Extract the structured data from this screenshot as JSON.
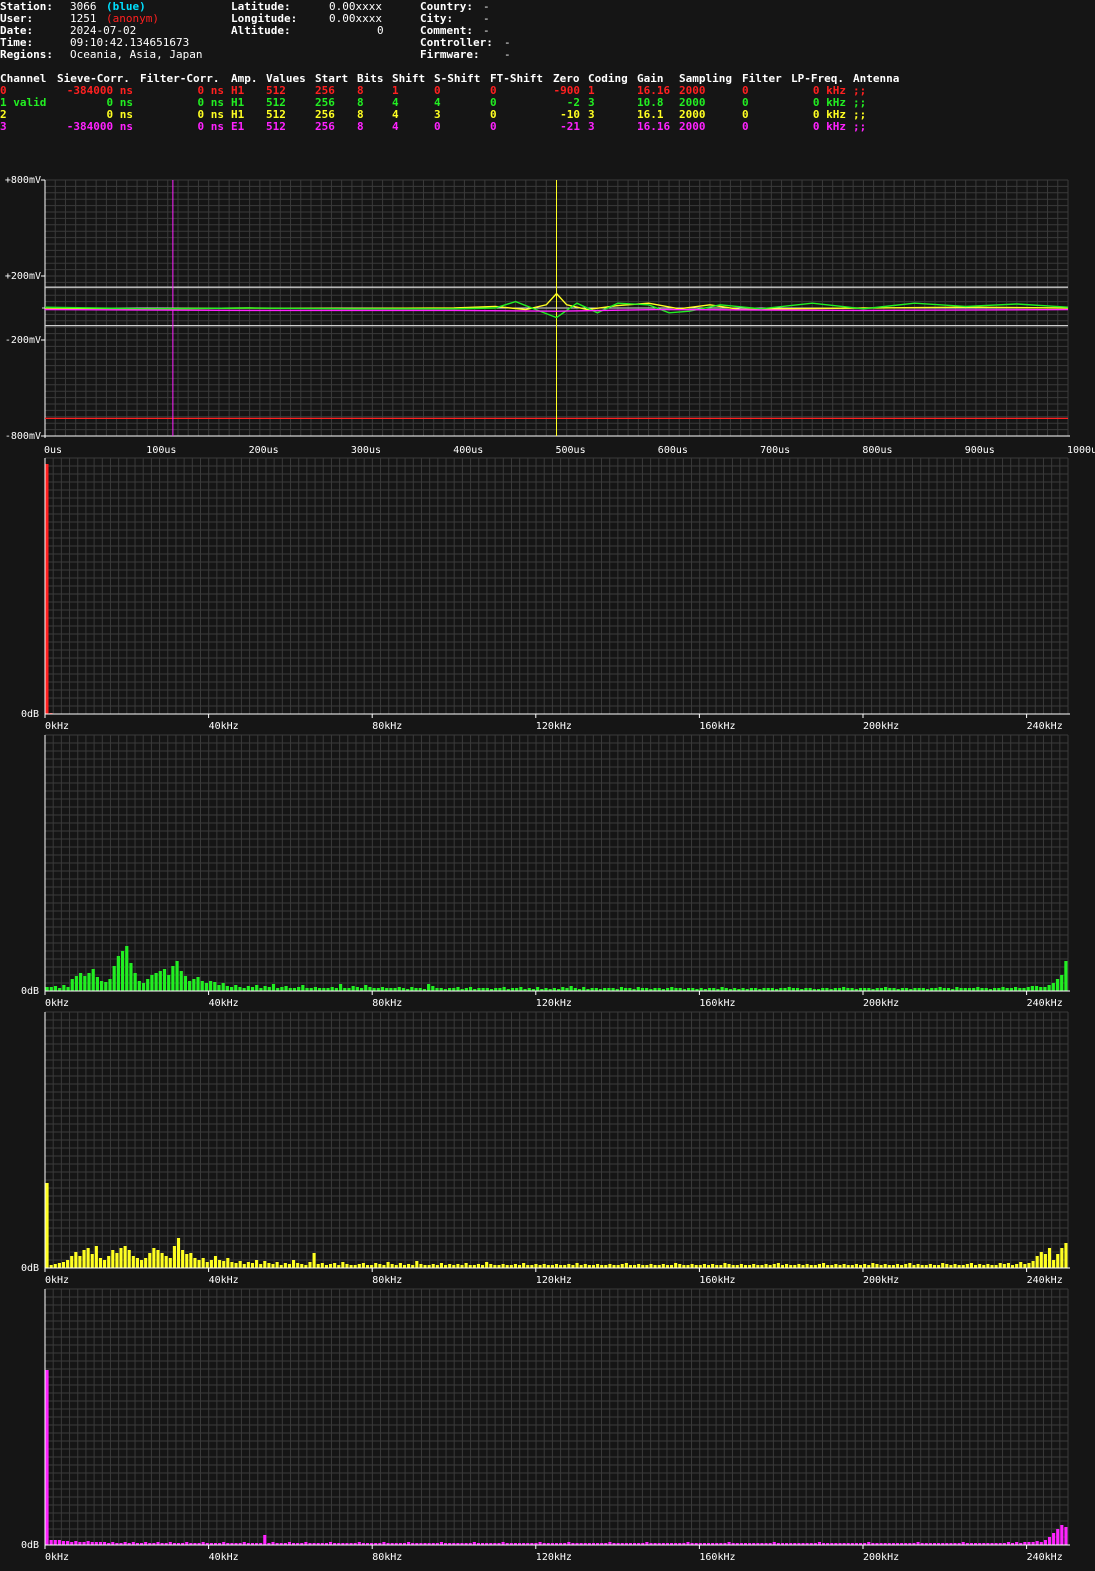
{
  "header": {
    "station_label": "Station:",
    "station_id": "3066",
    "station_tag": "(blue)",
    "user_label": "User:",
    "user_id": "1251",
    "user_tag": "(anonym)",
    "date_label": "Date:",
    "date": "2024-07-02",
    "time_label": "Time:",
    "time": "09:10:42.134651673",
    "regions_label": "Regions:",
    "regions": "Oceania, Asia, Japan",
    "latitude_label": "Latitude:",
    "latitude": "0.00xxxx",
    "longitude_label": "Longitude:",
    "longitude": "0.00xxxx",
    "altitude_label": "Altitude:",
    "altitude": "0",
    "country_label": "Country:",
    "country": "-",
    "city_label": "City:",
    "city": "-",
    "comment_label": "Comment:",
    "comment": "-",
    "controller_label": "Controller:",
    "controller": "-",
    "firmware_label": "Firmware:",
    "firmware": "-"
  },
  "colors": {
    "blue_tag": "#00e0ff",
    "anonym_tag": "#ff2020",
    "background": "#151515",
    "grid": "#3a3a3a"
  },
  "channel_table": {
    "headers": [
      "Channel",
      "Sieve-Corr.",
      "Filter-Corr.",
      "Amp.",
      "Values",
      "Start",
      "Bits",
      "Shift",
      "S-Shift",
      "FT-Shift",
      "Zero",
      "Coding",
      "Gain",
      "Sampling",
      "Filter",
      "LP-Freq.",
      "Antenna"
    ],
    "rows": [
      {
        "color": "#ff2020",
        "channel": "0",
        "sieve": "-384000 ns",
        "filter": "0 ns",
        "amp": "H1",
        "values": "512",
        "start": "256",
        "bits": "8",
        "shift": "1",
        "sshift": "0",
        "ftshift": "0",
        "zero": "-900",
        "coding": "1",
        "gain": "16.16",
        "sampling": "2000",
        "filt": "0",
        "lpfreq": "0 kHz",
        "antenna": ";;"
      },
      {
        "color": "#22ee22",
        "channel": "1 valid",
        "sieve": "0 ns",
        "filter": "0 ns",
        "amp": "H1",
        "values": "512",
        "start": "256",
        "bits": "8",
        "shift": "4",
        "sshift": "4",
        "ftshift": "0",
        "zero": "-2",
        "coding": "3",
        "gain": "10.8",
        "sampling": "2000",
        "filt": "0",
        "lpfreq": "0 kHz",
        "antenna": ";;"
      },
      {
        "color": "#ffff22",
        "channel": "2",
        "sieve": "0 ns",
        "filter": "0 ns",
        "amp": "H1",
        "values": "512",
        "start": "256",
        "bits": "8",
        "shift": "4",
        "sshift": "3",
        "ftshift": "0",
        "zero": "-10",
        "coding": "3",
        "gain": "16.1",
        "sampling": "2000",
        "filt": "0",
        "lpfreq": "0 kHz",
        "antenna": ";;"
      },
      {
        "color": "#ff22ff",
        "channel": "3",
        "sieve": "-384000 ns",
        "filter": "0 ns",
        "amp": "E1",
        "values": "512",
        "start": "256",
        "bits": "8",
        "shift": "4",
        "sshift": "0",
        "ftshift": "0",
        "zero": "-21",
        "coding": "3",
        "gain": "16.16",
        "sampling": "2000",
        "filt": "0",
        "lpfreq": "0 kHz",
        "antenna": ";;"
      }
    ]
  },
  "chart_data": [
    {
      "type": "line",
      "ylim": [
        -800,
        800
      ],
      "xlim": [
        0,
        1000
      ],
      "ytick_labels": [
        {
          "v": 800,
          "t": "+800mV"
        },
        {
          "v": 200,
          "t": "+200mV"
        },
        {
          "v": -200,
          "t": "-200mV"
        },
        {
          "v": -800,
          "t": "-800mV"
        }
      ],
      "xtick_labels": [
        "0us",
        "100us",
        "200us",
        "300us",
        "400us",
        "500us",
        "600us",
        "700us",
        "800us",
        "900us",
        "1000us"
      ],
      "hlines": [
        {
          "y": 130,
          "color": "#cccccc"
        },
        {
          "y": -110,
          "color": "#cccccc"
        },
        {
          "y": -690,
          "color": "#ff2020"
        }
      ],
      "vlines": [
        {
          "x": 125,
          "color": "#ff22ff"
        },
        {
          "x": 500,
          "color": "#ffff22"
        }
      ],
      "series": [
        {
          "color": "#ffff22",
          "x": [
            0,
            100,
            200,
            300,
            400,
            440,
            470,
            490,
            500,
            510,
            530,
            560,
            590,
            620,
            650,
            680,
            720,
            800,
            900,
            1000
          ],
          "values": [
            0,
            -5,
            0,
            -3,
            0,
            10,
            -10,
            20,
            90,
            20,
            -10,
            15,
            30,
            -5,
            20,
            -10,
            -5,
            0,
            5,
            0
          ]
        },
        {
          "color": "#22ee22",
          "x": [
            0,
            100,
            200,
            300,
            400,
            440,
            460,
            480,
            500,
            520,
            540,
            560,
            590,
            610,
            630,
            660,
            700,
            750,
            800,
            850,
            900,
            950,
            1000
          ],
          "values": [
            5,
            -5,
            0,
            -5,
            -5,
            0,
            40,
            -10,
            -60,
            30,
            -30,
            30,
            20,
            -30,
            -20,
            20,
            -5,
            30,
            -5,
            30,
            10,
            25,
            5
          ]
        },
        {
          "color": "#ff22ff",
          "x": [
            0,
            200,
            400,
            500,
            600,
            800,
            1000
          ],
          "values": [
            -10,
            -15,
            -15,
            -20,
            -10,
            -15,
            -10
          ]
        }
      ]
    },
    {
      "type": "bar",
      "color": "#ff2020",
      "xtick_labels": [
        "0kHz",
        "40kHz",
        "80kHz",
        "120kHz",
        "160kHz",
        "200kHz",
        "240kHz"
      ],
      "ylabel": "0dB",
      "values": [
        250,
        1,
        0,
        0,
        0,
        0,
        0,
        0,
        0,
        0,
        0,
        0,
        0,
        0,
        0,
        0,
        0,
        0,
        0,
        0,
        0,
        0,
        0,
        0,
        0,
        0,
        0,
        0,
        0,
        0,
        0,
        0,
        0,
        0,
        0,
        0,
        0,
        0,
        0,
        0,
        0,
        0,
        0,
        0,
        0,
        0,
        0,
        0,
        0,
        0,
        0,
        0,
        0,
        0,
        0,
        0,
        0,
        0,
        0,
        0,
        0,
        0,
        0,
        0,
        0,
        0,
        0,
        0,
        0,
        0,
        0,
        0,
        0,
        0,
        0,
        0,
        0,
        0,
        0,
        0,
        0,
        0,
        0,
        0,
        0,
        0,
        0,
        0,
        0,
        0,
        0,
        0,
        0,
        0,
        0,
        0,
        0,
        0,
        0,
        0,
        0,
        0,
        0,
        0,
        0,
        0,
        0,
        0,
        0,
        0,
        0,
        0,
        0,
        0,
        0,
        0,
        0,
        0,
        0,
        0,
        0,
        0,
        0,
        0,
        0,
        0,
        0,
        0,
        0,
        0,
        0,
        0,
        0,
        0,
        0,
        0,
        0,
        0,
        0,
        0,
        0,
        0,
        0,
        0,
        0,
        0,
        0,
        0,
        0,
        0,
        0,
        0,
        0,
        0,
        0,
        0,
        0,
        0,
        0,
        0,
        0,
        0,
        0,
        0,
        0,
        0,
        0,
        0,
        0,
        0,
        0,
        0,
        0,
        0,
        0,
        0,
        0,
        0,
        0,
        0,
        0,
        0,
        0,
        0,
        0,
        0,
        0,
        0,
        0,
        0,
        0,
        0,
        0,
        0,
        0,
        0,
        0,
        0,
        0,
        0,
        0,
        0,
        0,
        0,
        0,
        0,
        0,
        0,
        0,
        0,
        0,
        0,
        0,
        0,
        0,
        0,
        0,
        0,
        0,
        0,
        0,
        0,
        0,
        0,
        0,
        0,
        0,
        0,
        0,
        0,
        0,
        0,
        0,
        0,
        0,
        0,
        0,
        0,
        0,
        0,
        0,
        0,
        0,
        0,
        0,
        0,
        0,
        0,
        0,
        0,
        0,
        0,
        0,
        0,
        0
      ]
    },
    {
      "type": "bar",
      "color": "#22ee22",
      "xtick_labels": [
        "0kHz",
        "40kHz",
        "80kHz",
        "120kHz",
        "160kHz",
        "200kHz",
        "240kHz"
      ],
      "ylabel": "0dB",
      "values": [
        4,
        4,
        5,
        3,
        6,
        4,
        12,
        15,
        18,
        15,
        18,
        22,
        14,
        10,
        9,
        12,
        25,
        35,
        40,
        45,
        28,
        18,
        10,
        8,
        12,
        16,
        18,
        20,
        22,
        16,
        25,
        30,
        20,
        15,
        10,
        12,
        14,
        10,
        8,
        10,
        9,
        6,
        8,
        5,
        4,
        6,
        4,
        3,
        5,
        4,
        6,
        3,
        5,
        4,
        7,
        3,
        4,
        5,
        3,
        3,
        4,
        6,
        3,
        3,
        4,
        3,
        3,
        3,
        4,
        3,
        7,
        3,
        3,
        5,
        4,
        3,
        6,
        4,
        3,
        3,
        4,
        3,
        3,
        3,
        4,
        3,
        2,
        4,
        3,
        3,
        2,
        7,
        5,
        3,
        3,
        2,
        3,
        3,
        4,
        2,
        3,
        4,
        2,
        3,
        3,
        3,
        2,
        3,
        3,
        4,
        2,
        3,
        3,
        4,
        2,
        3,
        2,
        4,
        2,
        3,
        2,
        3,
        2,
        4,
        3,
        5,
        3,
        2,
        4,
        2,
        3,
        3,
        2,
        3,
        3,
        3,
        2,
        4,
        3,
        3,
        2,
        4,
        3,
        3,
        2,
        3,
        3,
        2,
        3,
        4,
        3,
        3,
        2,
        3,
        3,
        2,
        3,
        2,
        3,
        3,
        2,
        4,
        3,
        2,
        3,
        2,
        3,
        2,
        3,
        3,
        2,
        3,
        3,
        3,
        2,
        3,
        3,
        4,
        3,
        3,
        2,
        3,
        3,
        2,
        2,
        3,
        3,
        2,
        3,
        3,
        4,
        3,
        3,
        2,
        3,
        3,
        3,
        2,
        3,
        3,
        4,
        3,
        3,
        2,
        3,
        3,
        2,
        3,
        3,
        3,
        2,
        3,
        3,
        4,
        3,
        3,
        2,
        4,
        3,
        3,
        3,
        3,
        4,
        3,
        3,
        2,
        3,
        3,
        4,
        3,
        3,
        4,
        3,
        3,
        4,
        5,
        5,
        4,
        4,
        6,
        8,
        12,
        16,
        30
      ]
    },
    {
      "type": "bar",
      "color": "#ffff22",
      "xtick_labels": [
        "0kHz",
        "40kHz",
        "80kHz",
        "120kHz",
        "160kHz",
        "200kHz",
        "240kHz"
      ],
      "ylabel": "0dB",
      "values": [
        85,
        3,
        4,
        5,
        6,
        8,
        12,
        16,
        12,
        18,
        20,
        14,
        22,
        10,
        8,
        12,
        18,
        15,
        20,
        22,
        18,
        12,
        10,
        8,
        10,
        15,
        20,
        18,
        15,
        12,
        10,
        22,
        30,
        18,
        14,
        15,
        10,
        8,
        10,
        6,
        8,
        12,
        8,
        7,
        10,
        6,
        5,
        7,
        4,
        6,
        5,
        8,
        4,
        7,
        5,
        4,
        6,
        3,
        5,
        4,
        8,
        5,
        4,
        3,
        6,
        15,
        4,
        5,
        3,
        4,
        5,
        3,
        6,
        4,
        3,
        3,
        4,
        5,
        3,
        3,
        5,
        4,
        3,
        6,
        4,
        3,
        5,
        3,
        4,
        3,
        7,
        4,
        3,
        3,
        4,
        3,
        5,
        3,
        4,
        3,
        4,
        3,
        5,
        3,
        3,
        4,
        3,
        6,
        4,
        3,
        3,
        4,
        3,
        3,
        4,
        3,
        5,
        3,
        3,
        4,
        3,
        4,
        3,
        3,
        4,
        3,
        3,
        4,
        3,
        5,
        3,
        4,
        3,
        3,
        4,
        3,
        3,
        4,
        3,
        3,
        4,
        5,
        3,
        3,
        4,
        3,
        3,
        4,
        3,
        3,
        4,
        3,
        3,
        5,
        4,
        3,
        3,
        4,
        3,
        3,
        4,
        3,
        4,
        3,
        3,
        5,
        4,
        3,
        3,
        4,
        3,
        3,
        4,
        3,
        3,
        4,
        3,
        4,
        5,
        3,
        4,
        3,
        3,
        4,
        3,
        4,
        3,
        3,
        4,
        5,
        3,
        3,
        4,
        3,
        4,
        3,
        3,
        4,
        3,
        4,
        3,
        5,
        4,
        3,
        4,
        3,
        3,
        4,
        3,
        4,
        5,
        3,
        4,
        3,
        3,
        4,
        3,
        3,
        5,
        4,
        3,
        4,
        3,
        3,
        4,
        5,
        3,
        4,
        3,
        4,
        3,
        3,
        5,
        4,
        5,
        3,
        4,
        6,
        4,
        5,
        7,
        12,
        16,
        14,
        20,
        8,
        14,
        20,
        25
      ]
    },
    {
      "type": "bar",
      "color": "#ff22ff",
      "xtick_labels": [
        "0kHz",
        "40kHz",
        "80kHz",
        "120kHz",
        "160kHz",
        "200kHz",
        "240kHz"
      ],
      "ylabel": "0dB",
      "values": [
        175,
        5,
        5,
        5,
        4,
        4,
        3,
        4,
        3,
        3,
        4,
        3,
        3,
        3,
        3,
        2,
        3,
        2,
        2,
        3,
        2,
        3,
        2,
        2,
        3,
        2,
        2,
        3,
        2,
        2,
        3,
        2,
        2,
        2,
        3,
        2,
        2,
        2,
        3,
        2,
        2,
        2,
        2,
        3,
        2,
        2,
        2,
        2,
        3,
        2,
        2,
        2,
        2,
        10,
        2,
        3,
        2,
        2,
        2,
        3,
        2,
        2,
        2,
        3,
        2,
        2,
        2,
        2,
        2,
        3,
        2,
        2,
        2,
        2,
        2,
        2,
        3,
        2,
        2,
        2,
        2,
        2,
        3,
        2,
        2,
        2,
        2,
        2,
        3,
        2,
        2,
        2,
        2,
        2,
        2,
        2,
        3,
        2,
        2,
        2,
        2,
        2,
        2,
        2,
        3,
        2,
        2,
        2,
        2,
        2,
        2,
        3,
        2,
        2,
        2,
        2,
        2,
        2,
        2,
        2,
        3,
        2,
        2,
        2,
        2,
        2,
        2,
        3,
        2,
        2,
        2,
        2,
        2,
        2,
        2,
        2,
        2,
        3,
        2,
        2,
        2,
        2,
        2,
        2,
        2,
        2,
        3,
        2,
        2,
        2,
        2,
        2,
        2,
        2,
        2,
        2,
        3,
        2,
        2,
        2,
        2,
        2,
        2,
        2,
        2,
        2,
        3,
        2,
        2,
        2,
        2,
        2,
        2,
        2,
        2,
        2,
        2,
        3,
        2,
        2,
        2,
        2,
        2,
        2,
        2,
        2,
        2,
        2,
        3,
        2,
        2,
        2,
        2,
        2,
        2,
        2,
        2,
        2,
        2,
        2,
        3,
        2,
        2,
        2,
        2,
        2,
        2,
        2,
        2,
        2,
        2,
        2,
        3,
        2,
        2,
        2,
        2,
        2,
        2,
        2,
        2,
        2,
        2,
        3,
        2,
        2,
        2,
        2,
        2,
        2,
        2,
        2,
        2,
        2,
        3,
        2,
        3,
        2,
        3,
        3,
        3,
        4,
        3,
        5,
        8,
        12,
        16,
        20,
        18
      ]
    }
  ]
}
